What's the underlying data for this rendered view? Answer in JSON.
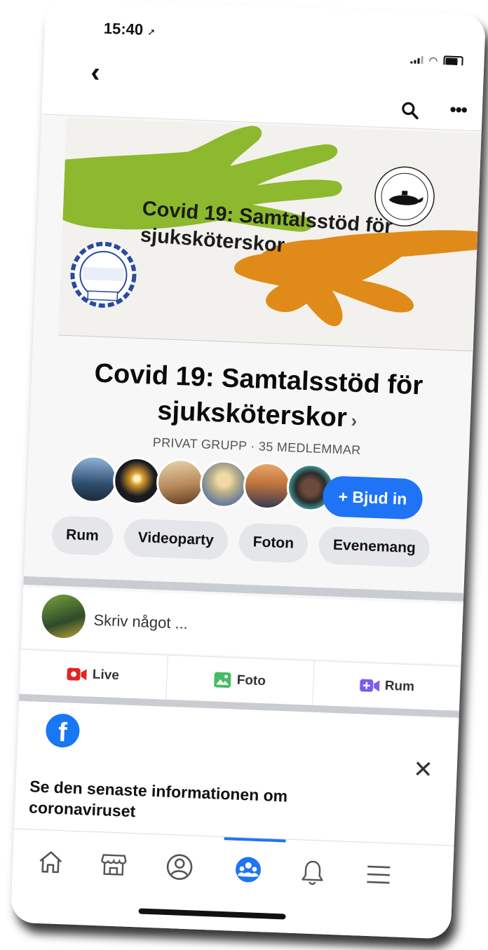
{
  "status_bar": {
    "time": "15:40"
  },
  "cover": {
    "title": "Covid 19: Samtalsstöd för sjuksköterskor"
  },
  "group": {
    "title": "Covid 19: Samtalsstöd för sjuksköterskor",
    "subtitle": "PRIVAT GRUPP · 35 MEDLEMMAR",
    "invite_label": "+ Bjud in"
  },
  "chips": [
    "Rum",
    "Videoparty",
    "Foton",
    "Evenemang"
  ],
  "composer": {
    "placeholder": "Skriv något ..."
  },
  "post_actions": [
    {
      "label": "Live",
      "icon": "live-video-icon",
      "color": "#e02424"
    },
    {
      "label": "Foto",
      "icon": "photo-icon",
      "color": "#45bd62"
    },
    {
      "label": "Rum",
      "icon": "room-video-icon",
      "color": "#7b5cf0"
    }
  ],
  "info_card": {
    "text": "Se den senaste informationen om coronaviruset"
  },
  "bottom_nav": [
    "home-icon",
    "marketplace-icon",
    "profile-icon",
    "groups-icon",
    "notifications-icon",
    "menu-icon"
  ],
  "colors": {
    "accent": "#1e74f5",
    "chip_bg": "#e5e6ea",
    "cover_green": "#8cb92d",
    "cover_orange": "#e08a1a"
  }
}
